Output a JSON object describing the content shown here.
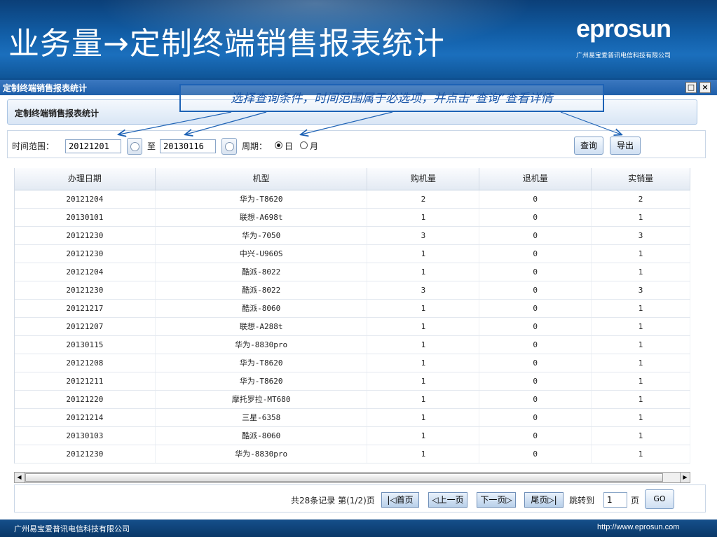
{
  "slide": {
    "title": "业务量→定制终端销售报表统计",
    "brand_logo": "eprosun",
    "brand_company": "广州易宝爱普讯电信科技有限公司",
    "footer_company": "广州易宝爱普讯电信科技有限公司",
    "footer_url": "http://www.eprosun.com"
  },
  "window": {
    "title": "定制终端销售报表统计",
    "restore_icon": "□",
    "close_icon": "×"
  },
  "panel": {
    "title": "定制终端销售报表统计"
  },
  "annotation": {
    "text": "选择查询条件，时间范围属于必选项，并点击“查询”查看详情"
  },
  "filter": {
    "time_range_label": "时间范围：",
    "start_date": "20121201",
    "to_label": "至",
    "end_date": "20130116",
    "period_label": "周期：",
    "period_options": [
      "日",
      "月"
    ],
    "period_selected": "日",
    "query_button": "查询",
    "export_button": "导出"
  },
  "table": {
    "columns": [
      "办理日期",
      "机型",
      "购机量",
      "退机量",
      "实销量"
    ],
    "rows": [
      [
        "20121204",
        "华为-T8620",
        "2",
        "0",
        "2"
      ],
      [
        "20130101",
        "联想-A698t",
        "1",
        "0",
        "1"
      ],
      [
        "20121230",
        "华为-7050",
        "3",
        "0",
        "3"
      ],
      [
        "20121230",
        "中兴-U960S",
        "1",
        "0",
        "1"
      ],
      [
        "20121204",
        "酷派-8022",
        "1",
        "0",
        "1"
      ],
      [
        "20121230",
        "酷派-8022",
        "3",
        "0",
        "3"
      ],
      [
        "20121217",
        "酷派-8060",
        "1",
        "0",
        "1"
      ],
      [
        "20121207",
        "联想-A288t",
        "1",
        "0",
        "1"
      ],
      [
        "20130115",
        "华为-8830pro",
        "1",
        "0",
        "1"
      ],
      [
        "20121208",
        "华为-T8620",
        "1",
        "0",
        "1"
      ],
      [
        "20121211",
        "华为-T8620",
        "1",
        "0",
        "1"
      ],
      [
        "20121220",
        "摩托罗拉-MT680",
        "1",
        "0",
        "1"
      ],
      [
        "20121214",
        "三星-6358",
        "1",
        "0",
        "1"
      ],
      [
        "20130103",
        "酷派-8060",
        "1",
        "0",
        "1"
      ],
      [
        "20121230",
        "华为-8830pro",
        "1",
        "0",
        "1"
      ]
    ]
  },
  "scrollbar": {
    "left_arrow": "◀",
    "right_arrow": "▶"
  },
  "pager": {
    "summary": "共28条记录 第(1/2)页",
    "first": "首页",
    "first_icon": "|◁",
    "prev": "上一页",
    "prev_icon": "◁",
    "next": "下一页",
    "next_icon": "▷",
    "last": "尾页",
    "last_icon": "▷|",
    "jump_label": "跳转到",
    "page_value": "1",
    "page_unit": "页",
    "go_button": "GO"
  },
  "colors": {
    "header_blue": "#125fa8",
    "annotation_blue": "#1a56a8"
  }
}
